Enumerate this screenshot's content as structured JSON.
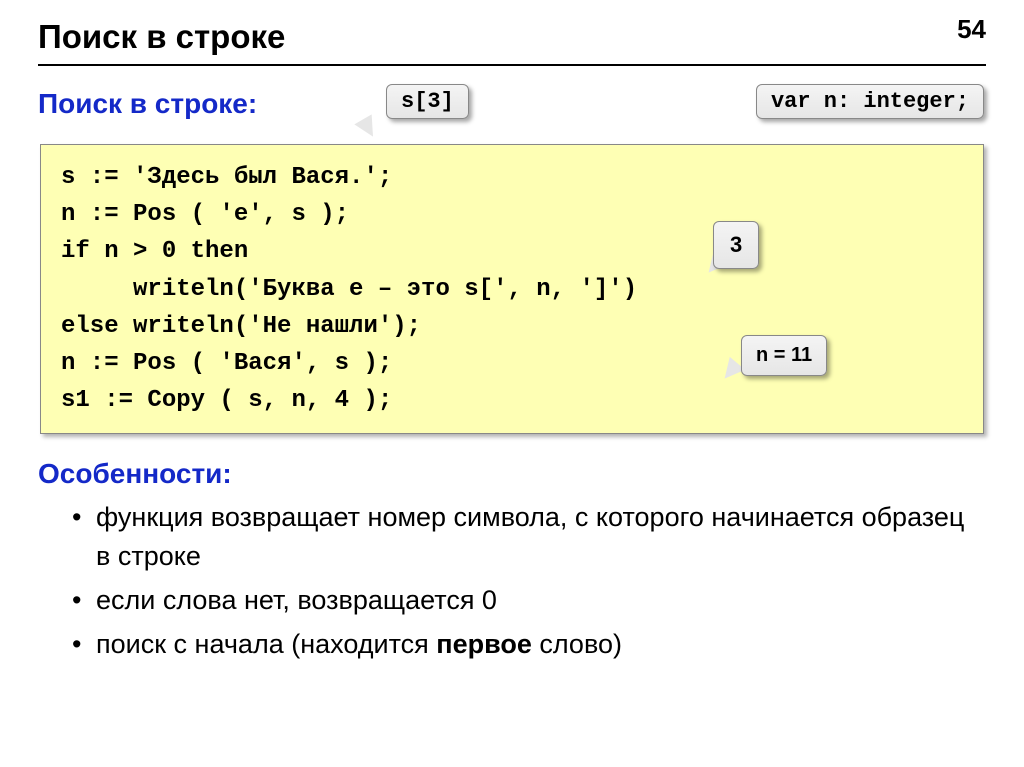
{
  "page_number": "54",
  "title": "Поиск в строке",
  "subtitle": "Поиск в строке:",
  "callout_s3": "s[3]",
  "callout_var": "var n: integer;",
  "code": "s := 'Здесь был Вася.';\nn := Pos ( 'е', s );\nif n > 0 then\n     writeln('Буква е – это s[', n, ']')\nelse writeln('Не нашли');\nn := Pos ( 'Вася', s );\ns1 := Copy ( s, n, 4 );",
  "callout_3": "3",
  "callout_n11": "n = 11",
  "features_label": "Особенности:",
  "bullets": [
    "функция возвращает номер символа, с которого начинается образец в строке",
    "если слова нет, возвращается 0"
  ],
  "bullet3_prefix": "поиск с начала (находится ",
  "bullet3_bold": "первое",
  "bullet3_suffix": " слово)"
}
